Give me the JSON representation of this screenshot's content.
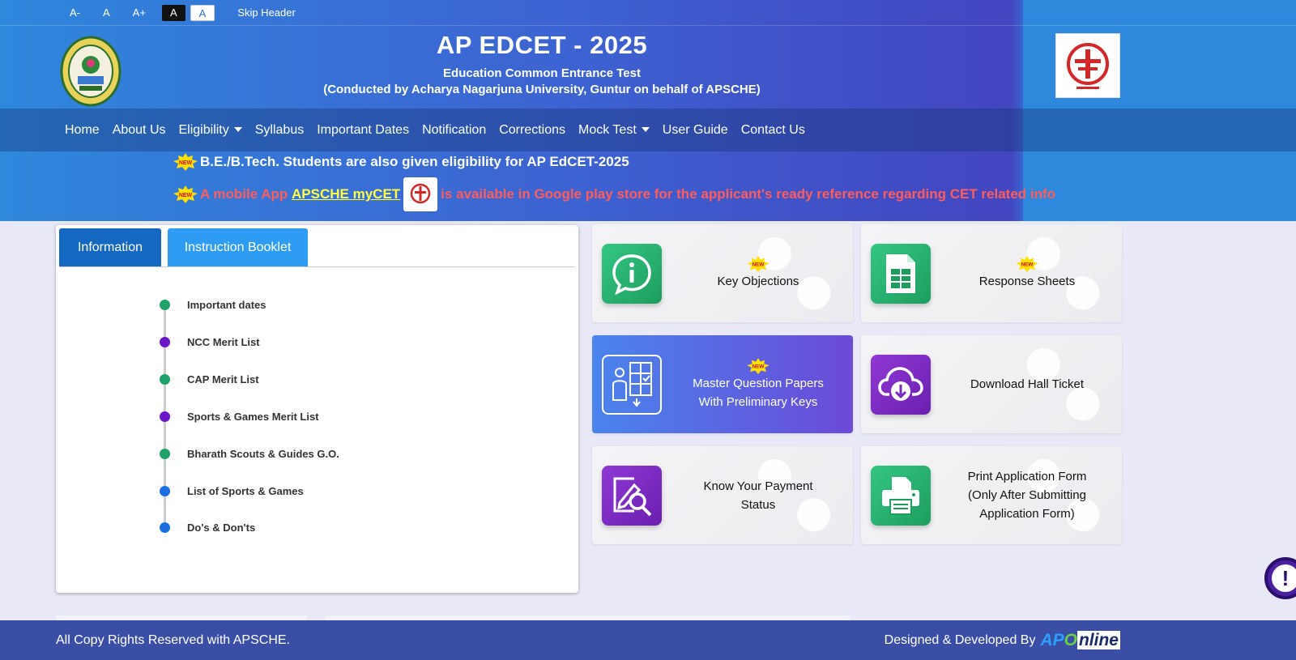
{
  "topbar": {
    "font_decrease": "A-",
    "font_normal": "A",
    "font_increase": "A+",
    "theme_dark": "A",
    "theme_light": "A",
    "skip_header": "Skip Header"
  },
  "header": {
    "title": "AP EDCET - 2025",
    "subtitle": "Education Common Entrance Test",
    "subtitle2": "(Conducted by Acharya Nagarjuna University, Guntur on behalf of APSCHE)"
  },
  "nav": {
    "items": [
      {
        "label": "Home"
      },
      {
        "label": "About Us"
      },
      {
        "label": "Eligibility",
        "dropdown": true
      },
      {
        "label": "Syllabus"
      },
      {
        "label": "Important Dates"
      },
      {
        "label": "Notification"
      },
      {
        "label": "Corrections"
      },
      {
        "label": "Mock Test",
        "dropdown": true
      },
      {
        "label": "User Guide"
      },
      {
        "label": "Contact Us"
      }
    ]
  },
  "news": {
    "line1": "B.E./B.Tech. Students are also given eligibility for AP EdCET-2025",
    "line2_prefix": "A mobile App",
    "line2_link": "APSCHE myCET",
    "line2_suffix": "is available in Google play store for the applicant's ready reference regarding CET related info",
    "badge_text": "NEW"
  },
  "info_panel": {
    "tabs": [
      {
        "label": "Information"
      },
      {
        "label": "Instruction Booklet"
      }
    ],
    "items": [
      {
        "label": "Important dates",
        "color": "#1fa36a"
      },
      {
        "label": "NCC Merit List",
        "color": "#6a17c8"
      },
      {
        "label": "CAP Merit List",
        "color": "#1fa36a"
      },
      {
        "label": "Sports & Games Merit List",
        "color": "#6a17c8"
      },
      {
        "label": "Bharath Scouts & Guides G.O.",
        "color": "#1fa36a"
      },
      {
        "label": "List of Sports & Games",
        "color": "#1c6fe0"
      },
      {
        "label": "Do's & Don'ts",
        "color": "#1c6fe0"
      }
    ]
  },
  "cards": {
    "key_objections": {
      "label": "Key Objections",
      "icon": "info-icon",
      "new": true
    },
    "response_sheets": {
      "label": "Response Sheets",
      "icon": "spreadsheet-icon",
      "new": true
    },
    "master_papers": {
      "label1": "Master Question Papers",
      "label2": "With Preliminary Keys",
      "icon": "question-paper-icon",
      "new": true
    },
    "hall_ticket": {
      "label": "Download Hall Ticket",
      "icon": "cloud-download-icon"
    },
    "payment_status": {
      "label1": "Know Your Payment",
      "label2": "Status",
      "icon": "search-document-icon"
    },
    "print_form": {
      "label1": "Print Application Form",
      "label2": "(Only After Submitting",
      "label3": "Application Form)",
      "icon": "printer-icon"
    }
  },
  "footer": {
    "copyright": "All Copy Rights Reserved with APSCHE.",
    "designed_by": "Designed & Developed By",
    "brand_a": "AP",
    "brand_o": "O",
    "brand_rest": "nline"
  },
  "colors": {
    "header_blue": "#2e88dc",
    "tab_active": "#1468c0",
    "tab_inactive": "#2e9cf2",
    "card_green": "#1d9d5e",
    "card_purple": "#6a1fb0",
    "footer": "#3a4ea6"
  }
}
